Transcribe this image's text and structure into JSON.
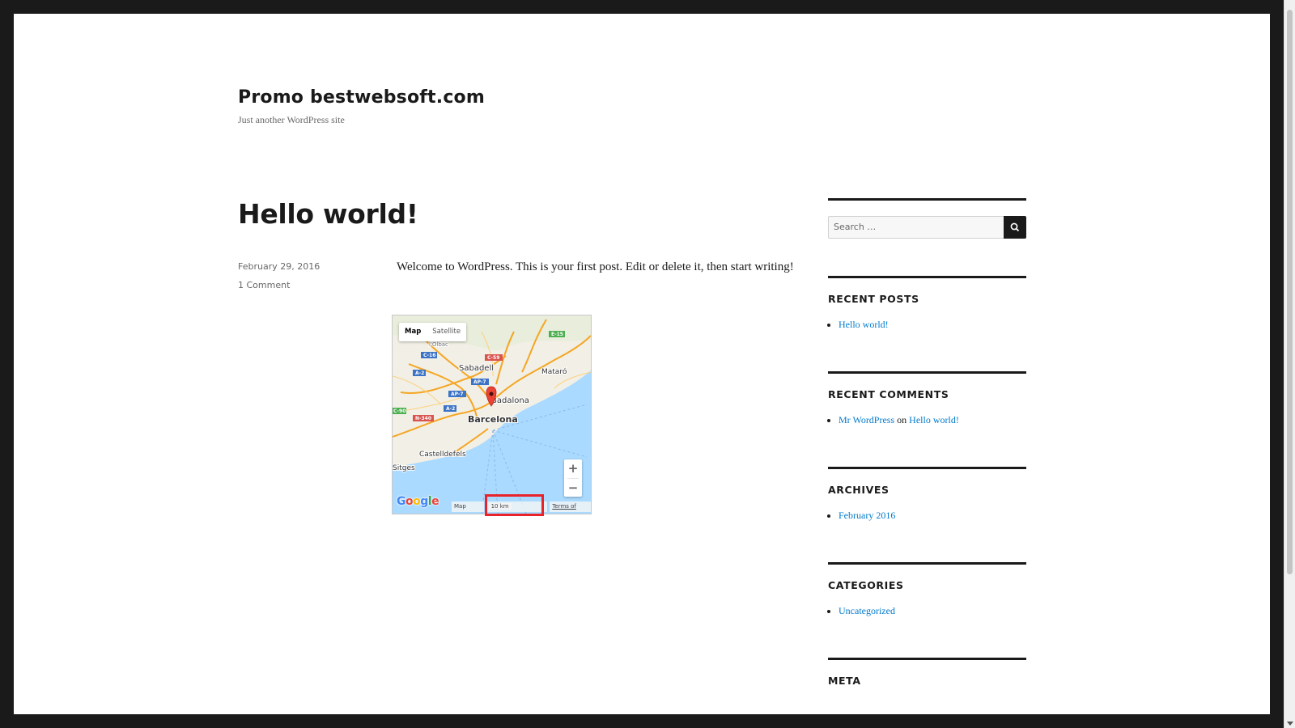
{
  "site": {
    "title": "Promo bestwebsoft.com",
    "description": "Just another WordPress site"
  },
  "post": {
    "title": "Hello world!",
    "date": "February 29, 2016",
    "comments_link": "1 Comment",
    "content": "Welcome to WordPress. This is your first post. Edit or delete it, then start writing!"
  },
  "map": {
    "type_buttons": [
      "Map",
      "Satellite"
    ],
    "active_type": "Map",
    "zoom_in": "+",
    "zoom_out": "−",
    "logo": "Google",
    "logo_colors": [
      "#4285f4",
      "#ea4335",
      "#fbbc05",
      "#4285f4",
      "#34a853",
      "#ea4335"
    ],
    "footer_data": "Map Data",
    "scale_label": "10 km",
    "terms": "Terms of Use",
    "places": [
      "Sabadell",
      "Mataró",
      "Badalona",
      "Barcelona",
      "Castelldefels",
      "Sitges",
      "l'Olbac"
    ],
    "road_labels": [
      "C-16",
      "C-59",
      "A-2",
      "AP-7",
      "AP-7",
      "A-2",
      "N-340",
      "E-15",
      "C-90"
    ],
    "marker_color": "#ea4335",
    "highlight_color": "#e8232a"
  },
  "sidebar": {
    "search_placeholder": "Search …",
    "search_icon": "search-icon",
    "recent_posts": {
      "title": "RECENT POSTS",
      "items": [
        "Hello world!"
      ]
    },
    "recent_comments": {
      "title": "RECENT COMMENTS",
      "author": "Mr WordPress",
      "on": "on",
      "post": "Hello world!"
    },
    "archives": {
      "title": "ARCHIVES",
      "items": [
        "February 2016"
      ]
    },
    "categories": {
      "title": "CATEGORIES",
      "items": [
        "Uncategorized"
      ]
    },
    "meta": {
      "title": "META"
    }
  },
  "colors": {
    "link": "#007acc",
    "text": "#1a1a1a",
    "meta": "#686868",
    "frame": "#1a1a1a"
  }
}
